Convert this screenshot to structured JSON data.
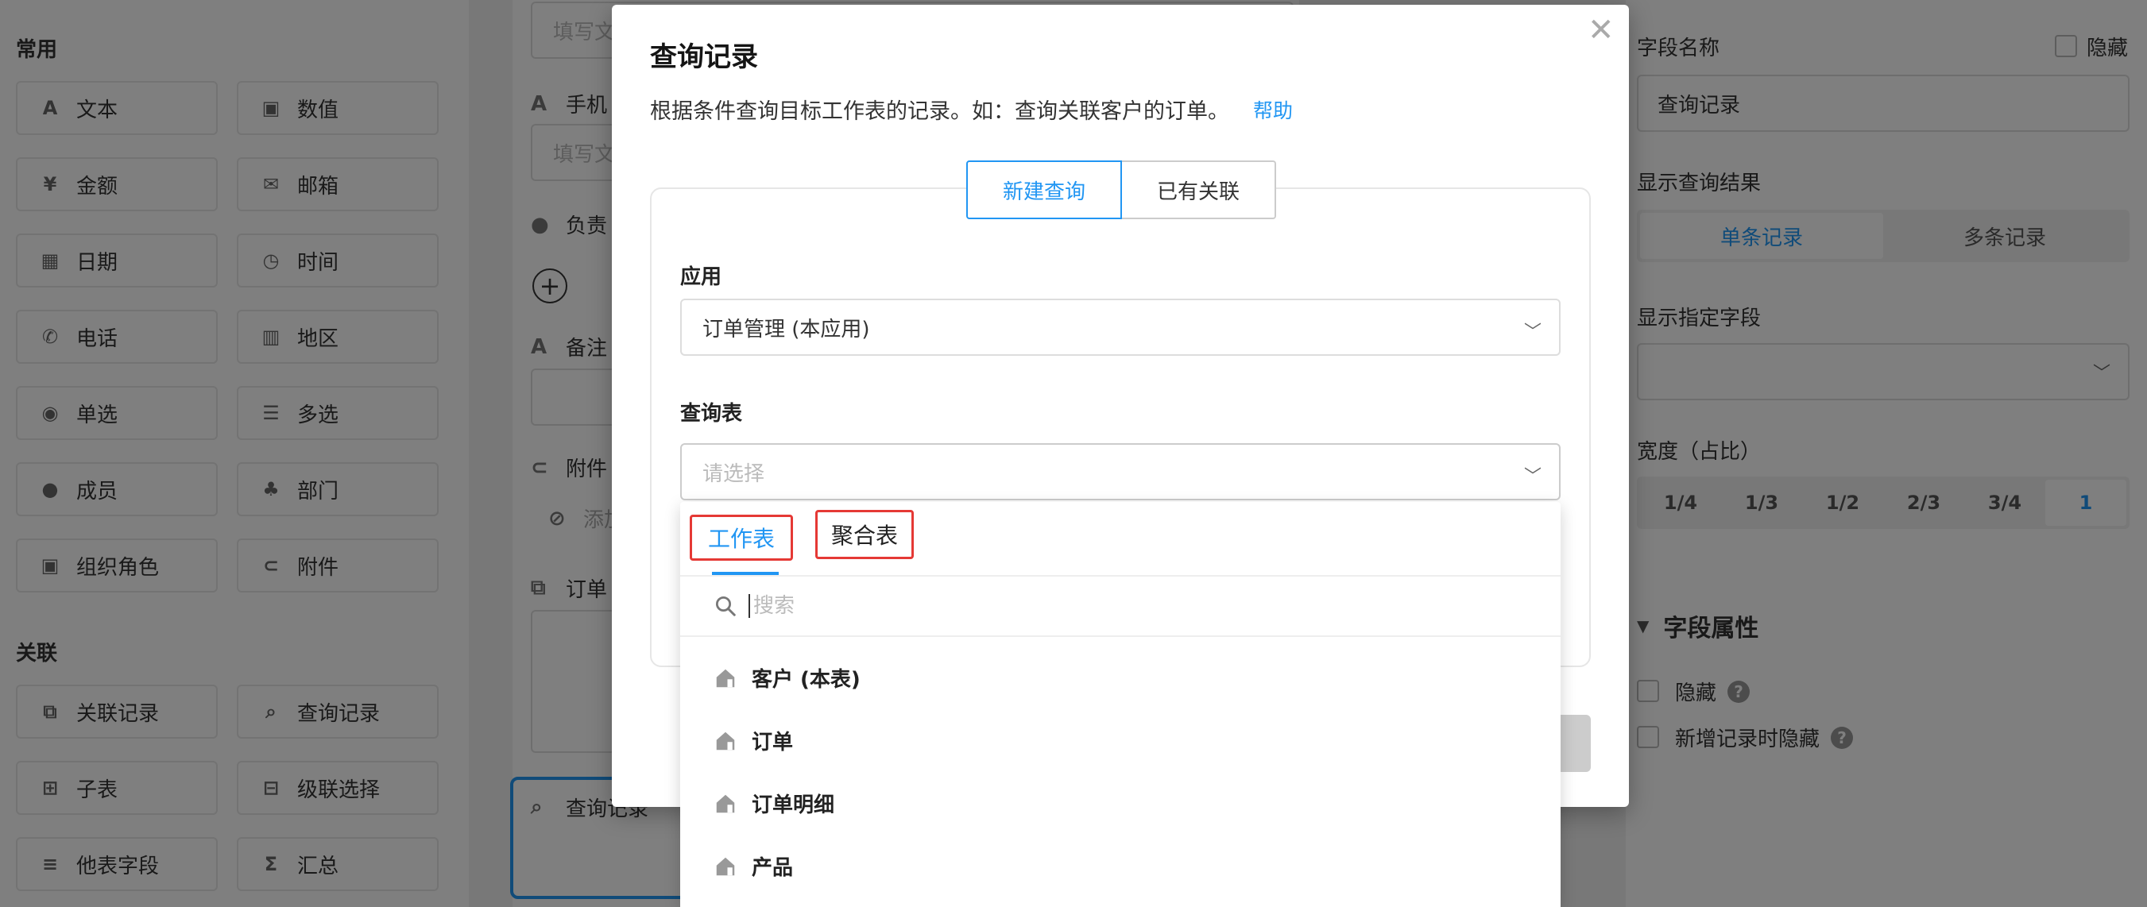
{
  "palette": {
    "section_common": "常用",
    "section_relation": "关联",
    "common_items": [
      {
        "label": "文本",
        "icon": "text-icon"
      },
      {
        "label": "数值",
        "icon": "number-icon"
      },
      {
        "label": "金额",
        "icon": "currency-icon"
      },
      {
        "label": "邮箱",
        "icon": "mail-icon"
      },
      {
        "label": "日期",
        "icon": "calendar-icon"
      },
      {
        "label": "时间",
        "icon": "clock-icon"
      },
      {
        "label": "电话",
        "icon": "phone-icon"
      },
      {
        "label": "地区",
        "icon": "map-icon"
      },
      {
        "label": "单选",
        "icon": "radio-icon"
      },
      {
        "label": "多选",
        "icon": "checklist-icon"
      },
      {
        "label": "成员",
        "icon": "user-icon"
      },
      {
        "label": "部门",
        "icon": "org-icon"
      },
      {
        "label": "组织角色",
        "icon": "role-icon"
      },
      {
        "label": "附件",
        "icon": "attachment-icon"
      }
    ],
    "relation_items": [
      {
        "label": "关联记录",
        "icon": "link-record-icon"
      },
      {
        "label": "查询记录",
        "icon": "query-record-icon"
      },
      {
        "label": "子表",
        "icon": "subtable-icon"
      },
      {
        "label": "级联选择",
        "icon": "cascade-icon"
      },
      {
        "label": "他表字段",
        "icon": "other-field-icon"
      },
      {
        "label": "汇总",
        "icon": "sum-icon"
      }
    ]
  },
  "form": {
    "input1_placeholder": "填写文",
    "phone_label": "手机",
    "input2_placeholder": "填写文",
    "owner_label": "负责",
    "note_label": "备注",
    "attachment_label": "附件",
    "attachment_add": "添加",
    "order_label": "订单",
    "query_field_label": "查询记录"
  },
  "right_panel": {
    "field_name_title": "字段名称",
    "hide_label": "隐藏",
    "field_name_value": "查询记录",
    "display_result_title": "显示查询结果",
    "single_record": "单条记录",
    "multi_record": "多条记录",
    "display_fields_title": "显示指定字段",
    "width_title": "宽度（占比）",
    "width_options": [
      "1/4",
      "1/3",
      "1/2",
      "2/3",
      "3/4",
      "1"
    ],
    "width_active": "1",
    "props_title": "字段属性",
    "prop_hide": "隐藏",
    "prop_hide_on_new": "新增记录时隐藏"
  },
  "modal": {
    "title": "查询记录",
    "description": "根据条件查询目标工作表的记录。如：查询关联客户的订单。",
    "help_link": "帮助",
    "tab_new": "新建查询",
    "tab_existing": "已有关联",
    "app_label": "应用",
    "app_value": "订单管理 (本应用)",
    "table_label": "查询表",
    "table_placeholder": "请选择"
  },
  "dropdown": {
    "tab_worksheet": "工作表",
    "tab_aggregate": "聚合表",
    "search_placeholder": "搜索",
    "items": [
      {
        "label": "客户 (本表)",
        "icon": "worksheet-icon"
      },
      {
        "label": "订单",
        "icon": "worksheet-icon"
      },
      {
        "label": "订单明细",
        "icon": "worksheet-icon"
      },
      {
        "label": "产品",
        "icon": "worksheet-icon"
      }
    ]
  }
}
